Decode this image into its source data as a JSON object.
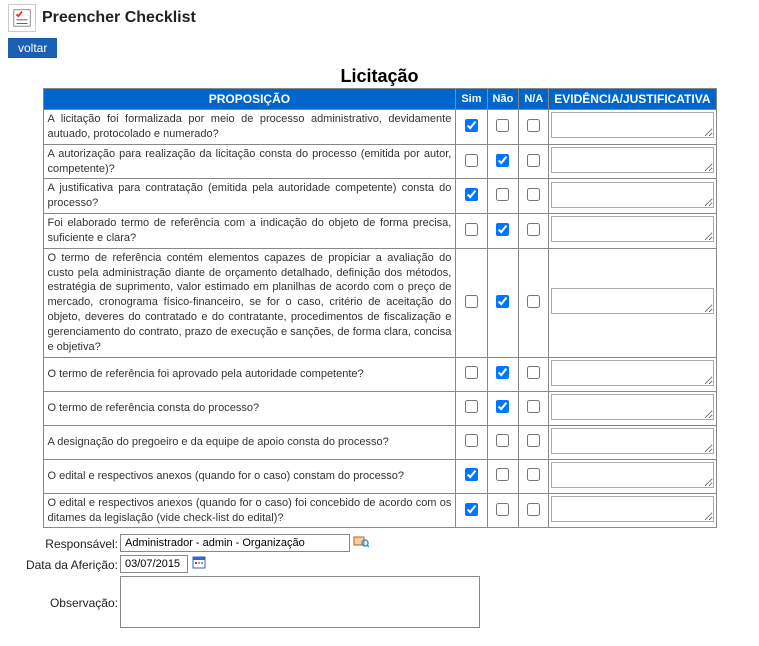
{
  "header": {
    "title": "Preencher Checklist",
    "back_label": "voltar"
  },
  "section_title": "Licitação",
  "table_headers": {
    "proposicao": "PROPOSIÇÃO",
    "sim": "Sim",
    "nao": "Não",
    "na": "N/A",
    "evidencia": "EVIDÊNCIA/JUSTIFICATIVA"
  },
  "rows": [
    {
      "text": "A licitação foi formalizada por meio de processo administrativo, devidamente autuado, protocolado e numerado?",
      "sim": true,
      "nao": false,
      "na": false,
      "evid": ""
    },
    {
      "text": "A autorização para realização da licitação consta do processo (emitida por autor, competente)?",
      "sim": false,
      "nao": true,
      "na": false,
      "evid": ""
    },
    {
      "text": "A justificativa para contratação (emitida pela autoridade competente) consta do processo?",
      "sim": true,
      "nao": false,
      "na": false,
      "evid": ""
    },
    {
      "text": "Foi elaborado termo de referência com a indicação do objeto de forma precisa, suficiente e clara?",
      "sim": false,
      "nao": true,
      "na": false,
      "evid": ""
    },
    {
      "text": "O termo de referência contém elementos capazes de propiciar a avaliação do custo pela administração diante de orçamento detalhado, definição dos métodos, estratégia de suprimento, valor estimado em planilhas de acordo com o preço de mercado, cronograma físico-financeiro, se for o caso, critério de aceitação do objeto, deveres do contratado e do contratante, procedimentos de fiscalização e gerenciamento do contrato, prazo de execução e sanções, de forma clara, concisa e objetiva?",
      "sim": false,
      "nao": true,
      "na": false,
      "evid": ""
    },
    {
      "text": "O termo de referência foi aprovado pela autoridade competente?",
      "sim": false,
      "nao": true,
      "na": false,
      "evid": ""
    },
    {
      "text": "O termo de referência consta do processo?",
      "sim": false,
      "nao": true,
      "na": false,
      "evid": ""
    },
    {
      "text": "A designação do pregoeiro e da equipe de apoio consta do processo?",
      "sim": false,
      "nao": false,
      "na": false,
      "evid": ""
    },
    {
      "text": "O edital e respectivos anexos (quando for o caso) constam do processo?",
      "sim": true,
      "nao": false,
      "na": false,
      "evid": ""
    },
    {
      "text": "O edital e respectivos anexos (quando for o caso) foi concebido de acordo com os ditames da legislação (vide check-list do edital)?",
      "sim": true,
      "nao": false,
      "na": false,
      "evid": ""
    }
  ],
  "footer": {
    "responsavel_label": "Responsável:",
    "responsavel_value": "Administrador - admin - Organização",
    "data_label": "Data da Aferição:",
    "data_value": "03/07/2015",
    "observacao_label": "Observação:",
    "observacao_value": ""
  }
}
